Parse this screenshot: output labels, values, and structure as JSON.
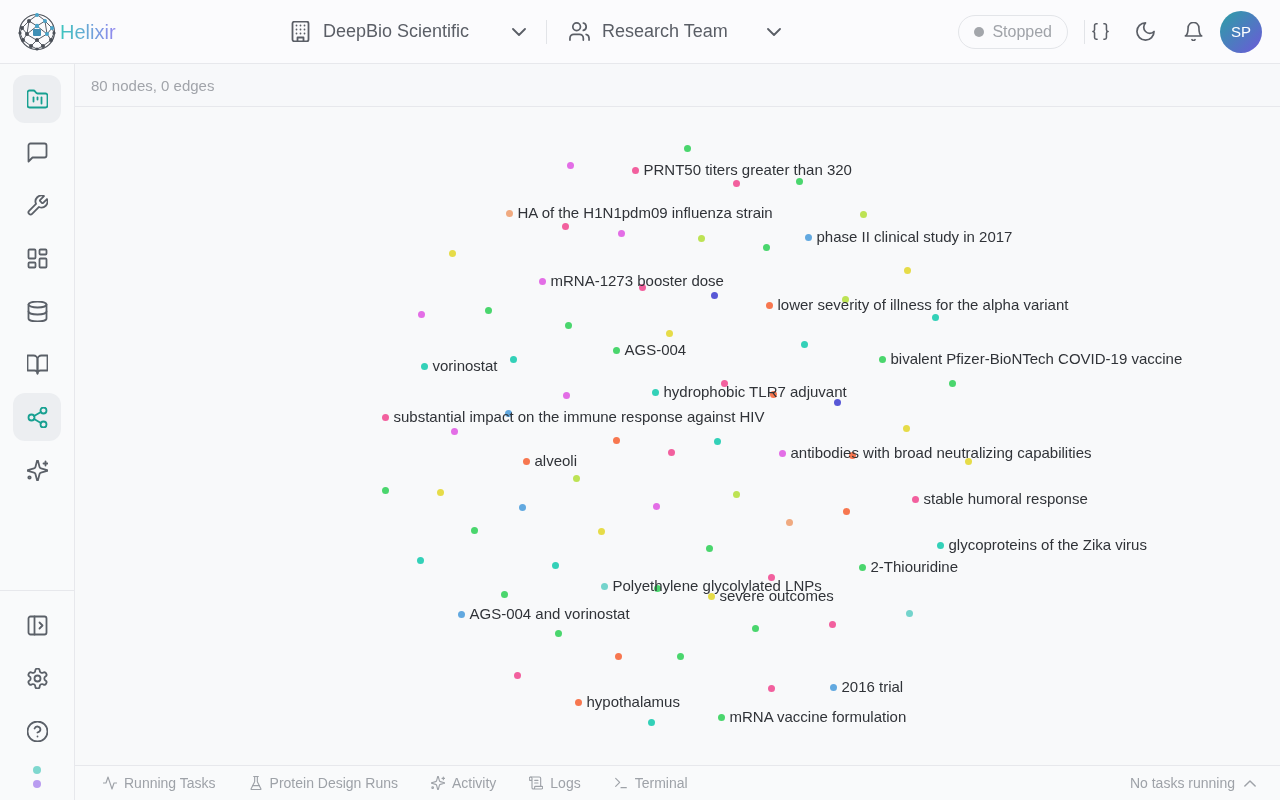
{
  "app": {
    "name": "Helixir"
  },
  "header": {
    "organization": "DeepBio Scientific",
    "team": "Research Team",
    "status": {
      "label": "Stopped",
      "running": false
    },
    "avatar": "SP"
  },
  "sidebar": {
    "items": [
      {
        "selected": true
      },
      {
        "selected": false
      },
      {
        "selected": false
      },
      {
        "selected": false
      },
      {
        "selected": false
      },
      {
        "selected": false
      },
      {
        "selected": true
      },
      {
        "selected": false
      }
    ],
    "status_dots": [
      {
        "color": "#7fd8cf"
      },
      {
        "color": "#b99cf0"
      }
    ]
  },
  "graph": {
    "summary": "80 nodes, 0 edges",
    "nodes": [
      {
        "color": "#4ad66d"
      },
      {
        "color": "#e36ee6"
      },
      {
        "label": "PRNT50 titers greater than 320",
        "color": "#f2609e"
      },
      {
        "color": "#4ad66d"
      },
      {
        "color": "#f2609e"
      },
      {
        "label": "HA of the H1N1pdm09 influenza strain",
        "color": "#f0aa80"
      },
      {
        "color": "#bde354"
      },
      {
        "color": "#f2609e"
      },
      {
        "color": "#e36ee6"
      },
      {
        "label": "phase II clinical study in 2017",
        "color": "#62a9e0"
      },
      {
        "color": "#bde354"
      },
      {
        "color": "#4ad66d"
      },
      {
        "color": "#e6dc48"
      },
      {
        "color": "#e6dc48"
      },
      {
        "label": "mRNA-1273 booster dose",
        "color": "#e36ee6"
      },
      {
        "color": "#f2609e"
      },
      {
        "color": "#5858d6"
      },
      {
        "color": "#bde354"
      },
      {
        "label": "lower severity of illness for the alpha variant",
        "color": "#f7774f"
      },
      {
        "color": "#4ad66d"
      },
      {
        "color": "#e36ee6"
      },
      {
        "color": "#33d1b8"
      },
      {
        "color": "#4ad66d"
      },
      {
        "color": "#e6dc48"
      },
      {
        "color": "#33d1b8"
      },
      {
        "label": "AGS-004",
        "color": "#4ad66d"
      },
      {
        "color": "#33d1b8"
      },
      {
        "label": "bivalent Pfizer-BioNTech COVID-19 vaccine",
        "color": "#4ad66d"
      },
      {
        "label": "vorinostat",
        "color": "#33d1b8"
      },
      {
        "color": "#f2609e"
      },
      {
        "color": "#4ad66d"
      },
      {
        "label": "hydrophobic TLR7 adjuvant",
        "color": "#33d1b8"
      },
      {
        "color": "#f7774f"
      },
      {
        "color": "#e36ee6"
      },
      {
        "color": "#5858d6"
      },
      {
        "color": "#62a9e0"
      },
      {
        "label": "substantial impact on the immune response against HIV",
        "color": "#f2609e"
      },
      {
        "color": "#e6dc48"
      },
      {
        "color": "#e36ee6"
      },
      {
        "color": "#f7774f"
      },
      {
        "color": "#33d1b8"
      },
      {
        "color": "#f2609e"
      },
      {
        "label": "antibodies with broad neutralizing capabilities",
        "color": "#e36ee6"
      },
      {
        "color": "#f7774f"
      },
      {
        "label": "alveoli",
        "color": "#f7774f"
      },
      {
        "color": "#e6dc48"
      },
      {
        "color": "#bde354"
      },
      {
        "color": "#4ad66d"
      },
      {
        "color": "#e6dc48"
      },
      {
        "color": "#bde354"
      },
      {
        "label": "stable humoral response",
        "color": "#f2609e"
      },
      {
        "color": "#e36ee6"
      },
      {
        "color": "#62a9e0"
      },
      {
        "color": "#f7774f"
      },
      {
        "color": "#f0aa80"
      },
      {
        "color": "#4ad66d"
      },
      {
        "color": "#e6dc48"
      },
      {
        "label": "glycoproteins of the Zika virus",
        "color": "#33d1b8"
      },
      {
        "color": "#4ad66d"
      },
      {
        "color": "#33d1b8"
      },
      {
        "color": "#33d1b8"
      },
      {
        "label": "2-Thiouridine",
        "color": "#4ad66d"
      },
      {
        "color": "#f2609e"
      },
      {
        "label": "Polyethylene glycolylated LNPs",
        "color": "#74d4cc"
      },
      {
        "color": "#4ad66d"
      },
      {
        "color": "#4ad66d"
      },
      {
        "label": "severe outcomes",
        "color": "#e6dc48"
      },
      {
        "color": "#74d4cc"
      },
      {
        "label": "AGS-004 and vorinostat",
        "color": "#62a9e0"
      },
      {
        "color": "#f2609e"
      },
      {
        "color": "#4ad66d"
      },
      {
        "color": "#4ad66d"
      },
      {
        "color": "#f7774f"
      },
      {
        "color": "#4ad66d"
      },
      {
        "color": "#f2609e"
      },
      {
        "label": "2016 trial",
        "color": "#62a9e0"
      },
      {
        "color": "#f2609e"
      },
      {
        "label": "hypothalamus",
        "color": "#f7774f"
      },
      {
        "label": "mRNA vaccine formulation",
        "color": "#4ad66d"
      },
      {
        "color": "#33d1b8"
      }
    ]
  },
  "bottom_bar": {
    "tabs": [
      {
        "label": "Running Tasks"
      },
      {
        "label": "Protein Design Runs"
      },
      {
        "label": "Activity"
      },
      {
        "label": "Logs"
      },
      {
        "label": "Terminal"
      }
    ],
    "status": "No tasks running"
  }
}
